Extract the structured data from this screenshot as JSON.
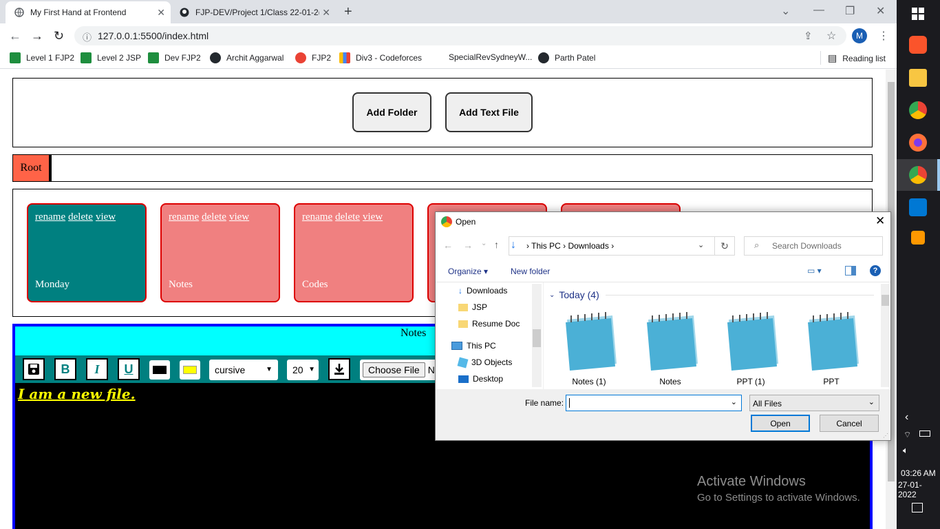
{
  "browser": {
    "tabs": [
      {
        "title": "My First Hand at Frontend"
      },
      {
        "title": "FJP-DEV/Project 1/Class 22-01-2("
      }
    ],
    "url": "127.0.0.1:5500/index.html",
    "profile_initial": "M",
    "bookmarks": [
      {
        "label": "Level 1 FJP2"
      },
      {
        "label": "Level 2 JSP"
      },
      {
        "label": "Dev FJP2"
      },
      {
        "label": "Archit Aggarwal"
      },
      {
        "label": "FJP2"
      },
      {
        "label": "Div3 - Codeforces"
      },
      {
        "label": "SpecialRevSydneyW..."
      },
      {
        "label": "Parth Patel"
      }
    ],
    "reading_list": "Reading list"
  },
  "app": {
    "add_folder": "Add Folder",
    "add_text_file": "Add Text File",
    "breadcrumb_root": "Root",
    "cards": [
      {
        "name": "Monday",
        "rename": "rename",
        "delete": "delete",
        "view": "view"
      },
      {
        "name": "Notes",
        "rename": "rename",
        "delete": "delete",
        "view": "view"
      },
      {
        "name": "Codes",
        "rename": "rename",
        "delete": "delete",
        "view": "view"
      }
    ],
    "notepad": {
      "title": "Notes",
      "font_family": "cursive",
      "font_size": "20",
      "choose_file": "Choose File",
      "no_file": "No",
      "content": "I am a new file."
    }
  },
  "dialog": {
    "title": "Open",
    "path": [
      "This PC",
      "Downloads"
    ],
    "search_placeholder": "Search Downloads",
    "organize": "Organize",
    "new_folder": "New folder",
    "nav_items": [
      {
        "label": "Downloads"
      },
      {
        "label": "JSP"
      },
      {
        "label": "Resume Doc"
      },
      {
        "label": "This PC"
      },
      {
        "label": "3D Objects"
      },
      {
        "label": "Desktop"
      }
    ],
    "group_header": "Today (4)",
    "files": [
      {
        "name": "Notes (1)"
      },
      {
        "name": "Notes"
      },
      {
        "name": "PPT (1)"
      },
      {
        "name": "PPT"
      }
    ],
    "file_name_label": "File name:",
    "file_type": "All Files",
    "open_button": "Open",
    "cancel_button": "Cancel"
  },
  "watermark": {
    "title": "Activate Windows",
    "subtitle": "Go to Settings to activate Windows."
  },
  "taskbar": {
    "time": "03:26 AM",
    "date": "27-01-2022"
  },
  "colors": {
    "card_selected": "#008080",
    "card": "#f08080",
    "root_crumb": "#ff6347",
    "notepad_header": "#00ffff",
    "notepad_toolbar": "#008080",
    "editor_text": "#ffff00"
  }
}
